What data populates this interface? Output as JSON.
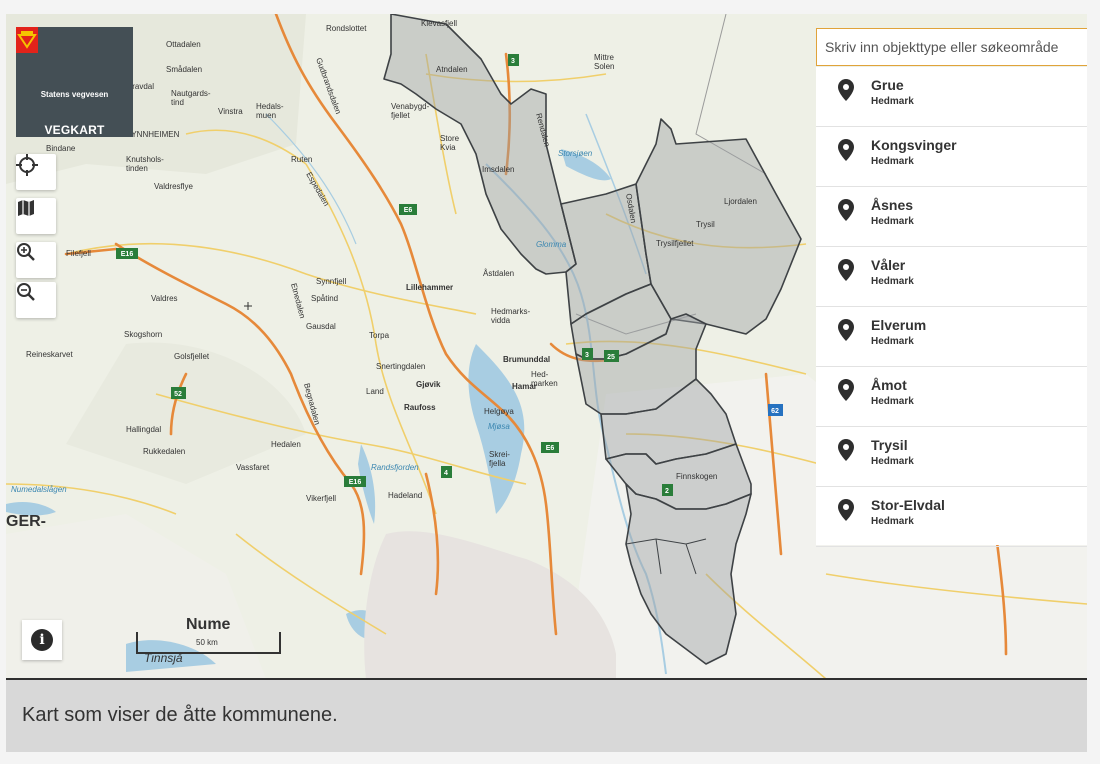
{
  "logo": {
    "org_name": "Statens vegvesen",
    "app_name": "VEGKART"
  },
  "search": {
    "placeholder": "Skriv inn objekttype eller søkeområde"
  },
  "results": [
    {
      "name": "Grue",
      "region": "Hedmark"
    },
    {
      "name": "Kongsvinger",
      "region": "Hedmark"
    },
    {
      "name": "Åsnes",
      "region": "Hedmark"
    },
    {
      "name": "Våler",
      "region": "Hedmark"
    },
    {
      "name": "Elverum",
      "region": "Hedmark"
    },
    {
      "name": "Åmot",
      "region": "Hedmark"
    },
    {
      "name": "Trysil",
      "region": "Hedmark"
    },
    {
      "name": "Stor-Elvdal",
      "region": "Hedmark"
    }
  ],
  "scale": {
    "label": "50 km"
  },
  "caption": "Kart som viser de åtte kommunene.",
  "map": {
    "labels": {
      "rondslottet": "Rondslottet",
      "ottadalen": "Ottadalen",
      "smadalen": "Smådalen",
      "gravdal": "Gravdal",
      "vinstra": "Vinstra",
      "hedalsmuen": "Hedals-\nmuen",
      "venabygd": "Venabygd-\nfjellet",
      "storekvia": "Store\nKvia",
      "ruten": "Ruten",
      "imsdalen": "Imsdalen",
      "storsjoen": "Storsjøen",
      "ljordalen": "Ljordalen",
      "trysil_map": "Trysil",
      "trysilfjellet": "Trysilfjellet",
      "osdalen": "Osdalen",
      "knutsholstinden": "Knutshols-\ntinden",
      "valdresflye": "Valdresflye",
      "filefjell": "Filefjell",
      "synnfjell": "Synnfjell",
      "spatind": "Spåtind",
      "lillehammer": "Lillehammer",
      "astdalen": "Åstdalen",
      "hedmarksvidda": "Hedmarks-\nvidda",
      "valdres": "Valdres",
      "skogshorn": "Skogshorn",
      "golsfjellet": "Golsfjellet",
      "reineskarvet": "Reineskarvet",
      "torpa": "Torpa",
      "snertingdalen": "Snertingdalen",
      "gjovik": "Gjøvik",
      "land": "Land",
      "raufoss": "Raufoss",
      "brumunddal": "Brumunddal",
      "hamar": "Hamar",
      "hedmarken": "Hed-\nmarken",
      "helgoya": "Helgøya",
      "mjosa": "Mjøsa",
      "hallingdal": "Hallingdal",
      "rukkedalen": "Rukkedalen",
      "hedalen": "Hedalen",
      "vassfaret": "Vassfaret",
      "randsfjorden": "Randsfjorden",
      "skreia": "Skrei-\nfjella",
      "finnskogen": "Finnskogen",
      "numedalslagen": "Numedalslågen",
      "vikerfjell": "Vikerfjell",
      "hadeland": "Hadeland",
      "solen": "Mittre\nSolen",
      "rendalen": "Rendalen",
      "glomma": "Glomma",
      "alvdalen": "Atndalen",
      "numedal": "Nume",
      "tinnsja": "Tinnsjå",
      "ger": "GER-",
      "gudbrandsdalen": "Gudbrandsdalen",
      "nordre": "Nautgards-\ntind",
      "sunnhemen": "SYNNHEIMEN",
      "bindane": "Bindane",
      "klevasfjell": "Klevasfjell",
      "espedalen": "Espedalen",
      "etnedalen": "Etnedalen",
      "begnadalen": "Begnadalen",
      "gausdal": "Gausdal"
    },
    "roads": {
      "e6a": "E6",
      "e6b": "E6",
      "e16a": "E16",
      "e16b": "E16",
      "r3a": "3",
      "r3b": "3",
      "r25": "25",
      "r52": "52",
      "r4": "4",
      "r2": "2",
      "r62": "62"
    }
  }
}
